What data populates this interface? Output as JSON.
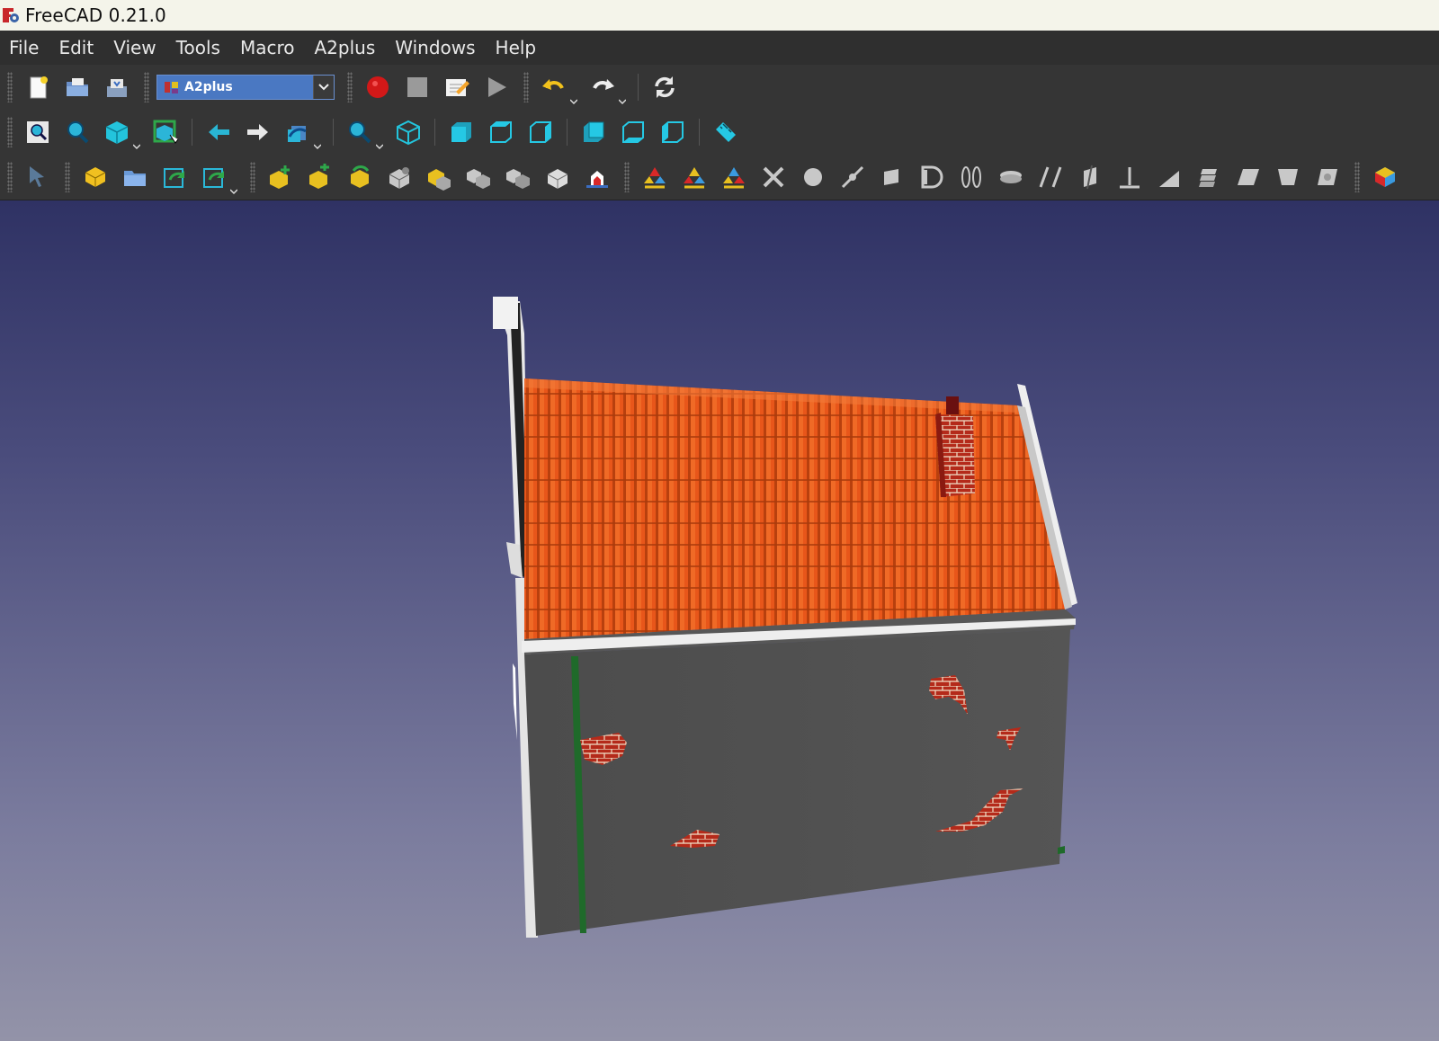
{
  "window": {
    "title": "FreeCAD 0.21.0"
  },
  "menu": [
    "File",
    "Edit",
    "View",
    "Tools",
    "Macro",
    "A2plus",
    "Windows",
    "Help"
  ],
  "toolbar1": {
    "workbench_selector": "A2plus",
    "buttons": [
      "new-document",
      "open-file",
      "save-file",
      "macro-record",
      "macro-stop",
      "macro-edit",
      "macro-run",
      "undo",
      "redo",
      "refresh"
    ]
  },
  "toolbar2": {
    "buttons": [
      "fit-all",
      "fit-selection",
      "draw-style",
      "bounding-box",
      "back-navigation",
      "forward-navigation",
      "sync-view",
      "std-view-menu",
      "isometric-view",
      "front-view",
      "top-view",
      "right-view",
      "rear-view",
      "bottom-view",
      "left-view",
      "measure"
    ]
  },
  "toolbar3": {
    "buttons": [
      "select",
      "add-part",
      "add-from-folder",
      "update-imported",
      "edit-imported",
      "add-constraints",
      "convert-part",
      "duplicate-part",
      "solve",
      "flip",
      "toggle-transparency",
      "show-connected",
      "hide-part",
      "isolate",
      "point-identity",
      "point-on-line",
      "point-on-plane",
      "sphere-center",
      "circular-edge",
      "axis-coincident",
      "axis-parallel",
      "axis-plane-parallel",
      "axis-plane-normal",
      "axis-plane-angle",
      "plane-coincident",
      "angled-planes",
      "center-of-mass",
      "delete-constraints",
      "clear-x",
      "circle",
      "line-point",
      "square",
      "half-circle",
      "parallel-ellipses",
      "disk",
      "double-slash",
      "plane-slash",
      "perpendicular",
      "angle",
      "layers",
      "parallelogram",
      "trapezoid",
      "rounded-square",
      "overflow"
    ]
  },
  "viewport": {
    "background_top": "#2f3264",
    "background_bottom": "#9393a8",
    "model": "house",
    "roof_color": "#e8561a",
    "wall_color": "#505050",
    "trim_color": "#e6e6e6",
    "brick_color": "#b42a1a"
  }
}
